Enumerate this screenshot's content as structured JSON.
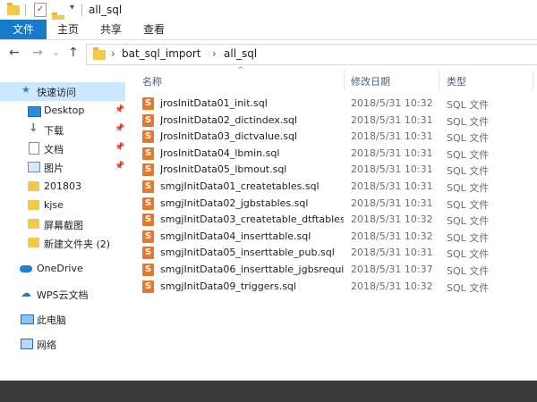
{
  "window": {
    "title": "all_sql"
  },
  "ribbon": {
    "file": "文件",
    "home": "主页",
    "share": "共享",
    "view": "查看"
  },
  "nav": {
    "back": "←",
    "forward": "→",
    "recent": "⌄",
    "up": "↑"
  },
  "address": {
    "crumbs": [
      "bat_sql_import",
      "all_sql"
    ],
    "separator": "›"
  },
  "sidebar": {
    "items": [
      {
        "label": "快速访问",
        "icon": "star-icon"
      },
      {
        "label": "Desktop",
        "icon": "desktop-icon",
        "pinned": true
      },
      {
        "label": "下载",
        "icon": "download-icon",
        "pinned": true
      },
      {
        "label": "文档",
        "icon": "document-icon",
        "pinned": true
      },
      {
        "label": "图片",
        "icon": "picture-icon",
        "pinned": true
      },
      {
        "label": "201803",
        "icon": "folder-icon"
      },
      {
        "label": "kjse",
        "icon": "folder-icon"
      },
      {
        "label": "屏幕截图",
        "icon": "folder-icon"
      },
      {
        "label": "新建文件夹 (2)",
        "icon": "folder-icon"
      },
      {
        "label": "OneDrive",
        "icon": "cloud-icon"
      },
      {
        "label": "WPS云文档",
        "icon": "wps-cloud-icon"
      },
      {
        "label": "此电脑",
        "icon": "computer-icon"
      },
      {
        "label": "网络",
        "icon": "network-icon"
      }
    ],
    "pin_glyph": "📌"
  },
  "columns": {
    "name": "名称",
    "date": "修改日期",
    "type": "类型",
    "sort_indicator": "^"
  },
  "files": [
    {
      "name": "jrosInitData01_init.sql",
      "date": "2018/5/31 10:32",
      "type": "SQL 文件"
    },
    {
      "name": "JrosInitData02_dictindex.sql",
      "date": "2018/5/31 10:31",
      "type": "SQL 文件"
    },
    {
      "name": "JrosInitData03_dictvalue.sql",
      "date": "2018/5/31 10:31",
      "type": "SQL 文件"
    },
    {
      "name": "JrosInitData04_lbmin.sql",
      "date": "2018/5/31 10:31",
      "type": "SQL 文件"
    },
    {
      "name": "JrosInitData05_lbmout.sql",
      "date": "2018/5/31 10:31",
      "type": "SQL 文件"
    },
    {
      "name": "smgjInitData01_createtables.sql",
      "date": "2018/5/31 10:31",
      "type": "SQL 文件"
    },
    {
      "name": "smgjInitData02_jgbstables.sql",
      "date": "2018/5/31 10:31",
      "type": "SQL 文件"
    },
    {
      "name": "smgjInitData03_createtable_dtftables.",
      "date": "2018/5/31 10:32",
      "type": "SQL 文件"
    },
    {
      "name": "smgjInitData04_inserttable.sql",
      "date": "2018/5/31 10:32",
      "type": "SQL 文件"
    },
    {
      "name": "smgjInitData05_inserttable_pub.sql",
      "date": "2018/5/31 10:31",
      "type": "SQL 文件"
    },
    {
      "name": "smgjInitData06_inserttable_jgbsrequi...",
      "date": "2018/5/31 10:37",
      "type": "SQL 文件"
    },
    {
      "name": "smgjInitData09_triggers.sql",
      "date": "2018/5/31 10:32",
      "type": "SQL 文件"
    }
  ],
  "colors": {
    "accent": "#1979ca",
    "selected": "#cce8ff",
    "sql_icon": "#e8762b"
  }
}
